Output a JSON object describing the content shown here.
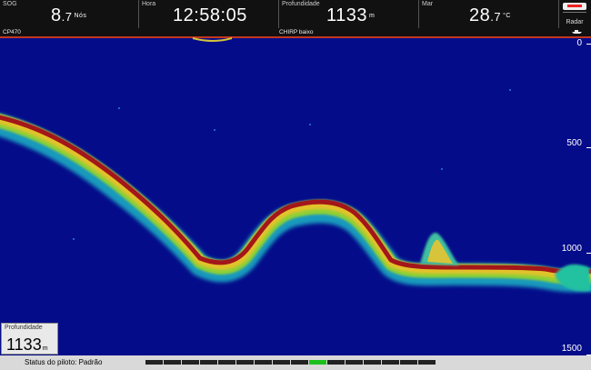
{
  "databar": {
    "sog": {
      "label": "SOG",
      "int": "8",
      "dec": ".7",
      "unit": "Nós"
    },
    "time": {
      "label": "Hora",
      "value": "12:58:05"
    },
    "depth": {
      "label": "Profundidade",
      "value": "1133",
      "unit": "m"
    },
    "sea": {
      "label": "Mar",
      "int": "28",
      "dec": ".7",
      "unit": "°C"
    },
    "radar": {
      "label": "Radar"
    }
  },
  "strip": {
    "left": "CP470",
    "center": "CHIRP baixo"
  },
  "scale": {
    "ticks": [
      "0",
      "500",
      "1000",
      "1500"
    ]
  },
  "depth_box": {
    "label": "Profundidade",
    "value": "1133",
    "unit": "m"
  },
  "status": {
    "text": "Status do piloto: Padrão",
    "segments": 16,
    "active_segment": 9
  },
  "colors": {
    "water": "#050c8a",
    "bottom_core": "#8b0f0f",
    "bottom_outer": "#d4b22a",
    "fringe": "#17b6c5"
  }
}
